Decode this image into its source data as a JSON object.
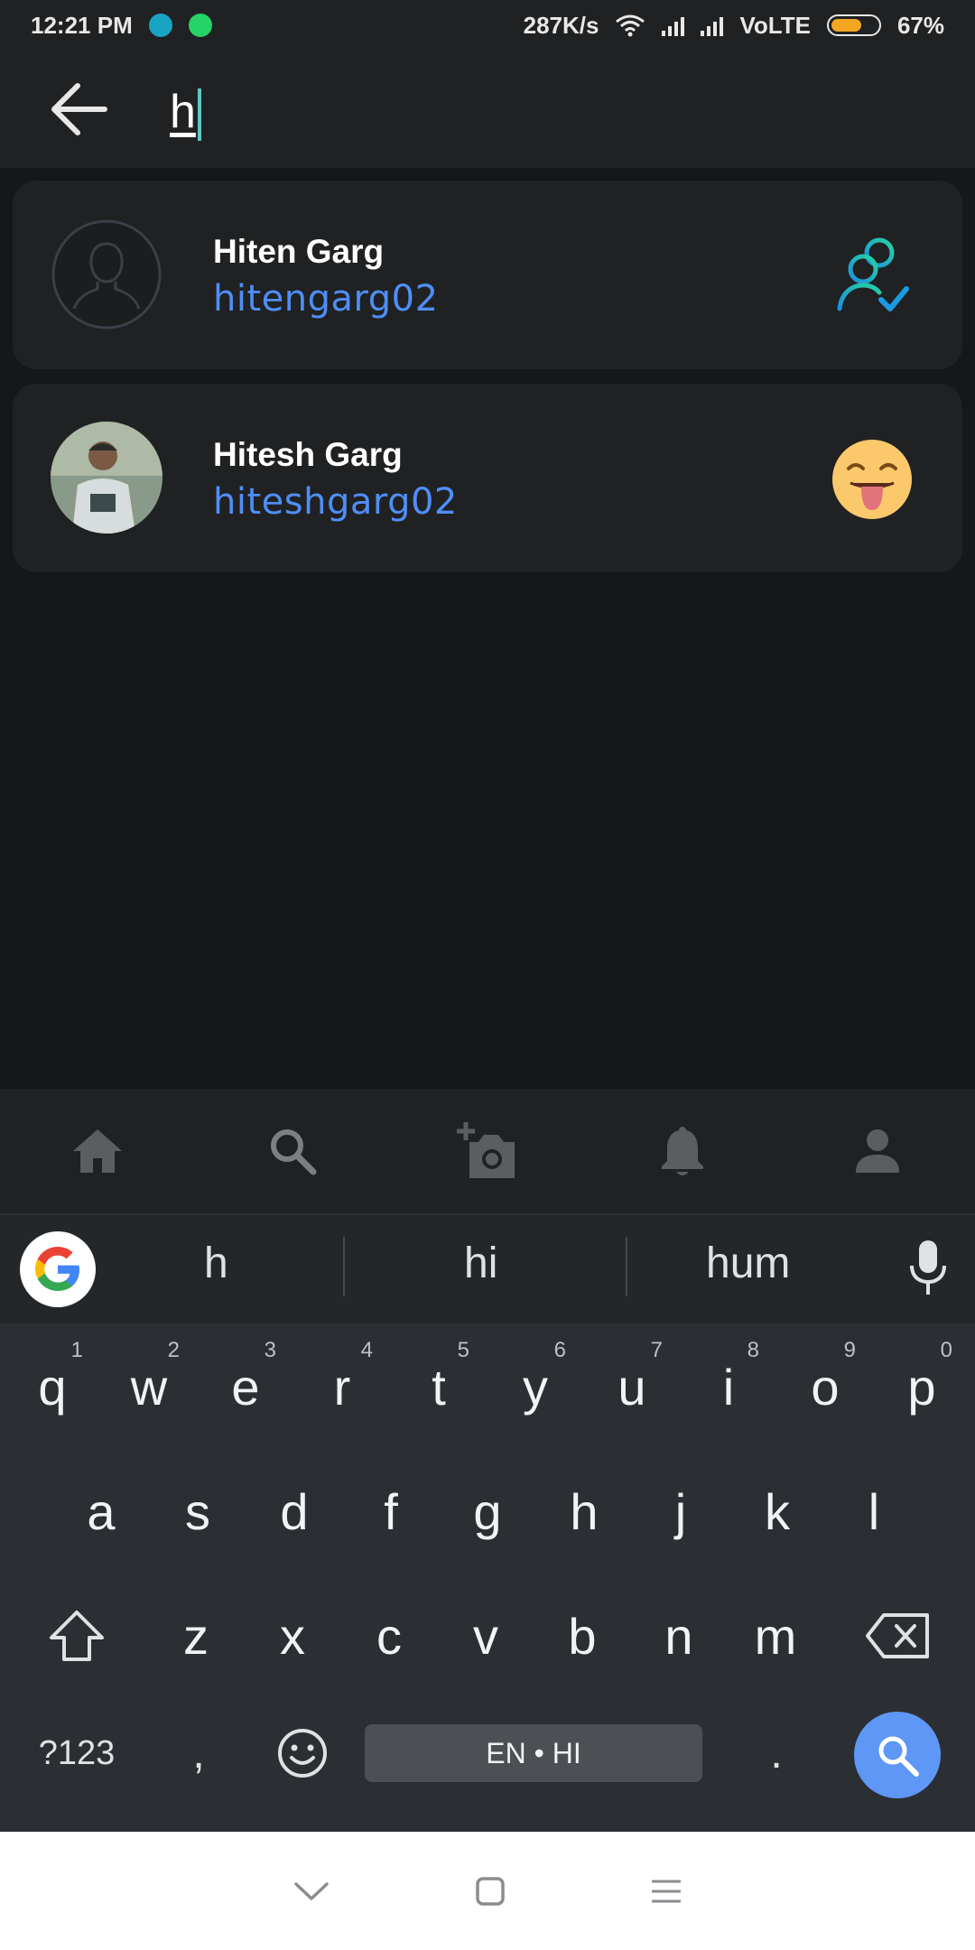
{
  "status_bar": {
    "time": "12:21 PM",
    "network_speed": "287K/s",
    "network_type": "VoLTE",
    "battery_percent": "67%",
    "battery_level": 0.67,
    "notification_icons": [
      "droplet-app-icon",
      "whatsapp-icon"
    ]
  },
  "search": {
    "query": "h"
  },
  "results": [
    {
      "name": "Hiten Garg",
      "username": "hitengarg02",
      "avatar": "default-person-avatar",
      "action_icon": "friends-check-icon"
    },
    {
      "name": "Hitesh Garg",
      "username": "hiteshgarg02",
      "avatar": "user-photo-avatar",
      "action_icon": "tongue-out-emoji-icon"
    }
  ],
  "bottom_nav": [
    "home-icon",
    "search-icon",
    "add-photo-icon",
    "bell-icon",
    "profile-icon"
  ],
  "keyboard": {
    "suggestions": [
      "h",
      "hi",
      "hum"
    ],
    "row1": [
      {
        "k": "q",
        "n": "1"
      },
      {
        "k": "w",
        "n": "2"
      },
      {
        "k": "e",
        "n": "3"
      },
      {
        "k": "r",
        "n": "4"
      },
      {
        "k": "t",
        "n": "5"
      },
      {
        "k": "y",
        "n": "6"
      },
      {
        "k": "u",
        "n": "7"
      },
      {
        "k": "i",
        "n": "8"
      },
      {
        "k": "o",
        "n": "9"
      },
      {
        "k": "p",
        "n": "0"
      }
    ],
    "row2": [
      "a",
      "s",
      "d",
      "f",
      "g",
      "h",
      "j",
      "k",
      "l"
    ],
    "row3": [
      "z",
      "x",
      "c",
      "v",
      "b",
      "n",
      "m"
    ],
    "symbols_label": "?123",
    "comma": ",",
    "period": ".",
    "space_label": "EN • HI"
  },
  "colors": {
    "accent_blue": "#4f8ef7",
    "caret_teal": "#5fc8c4",
    "search_key_blue": "#5e97f6",
    "battery_orange": "#f5a623"
  }
}
